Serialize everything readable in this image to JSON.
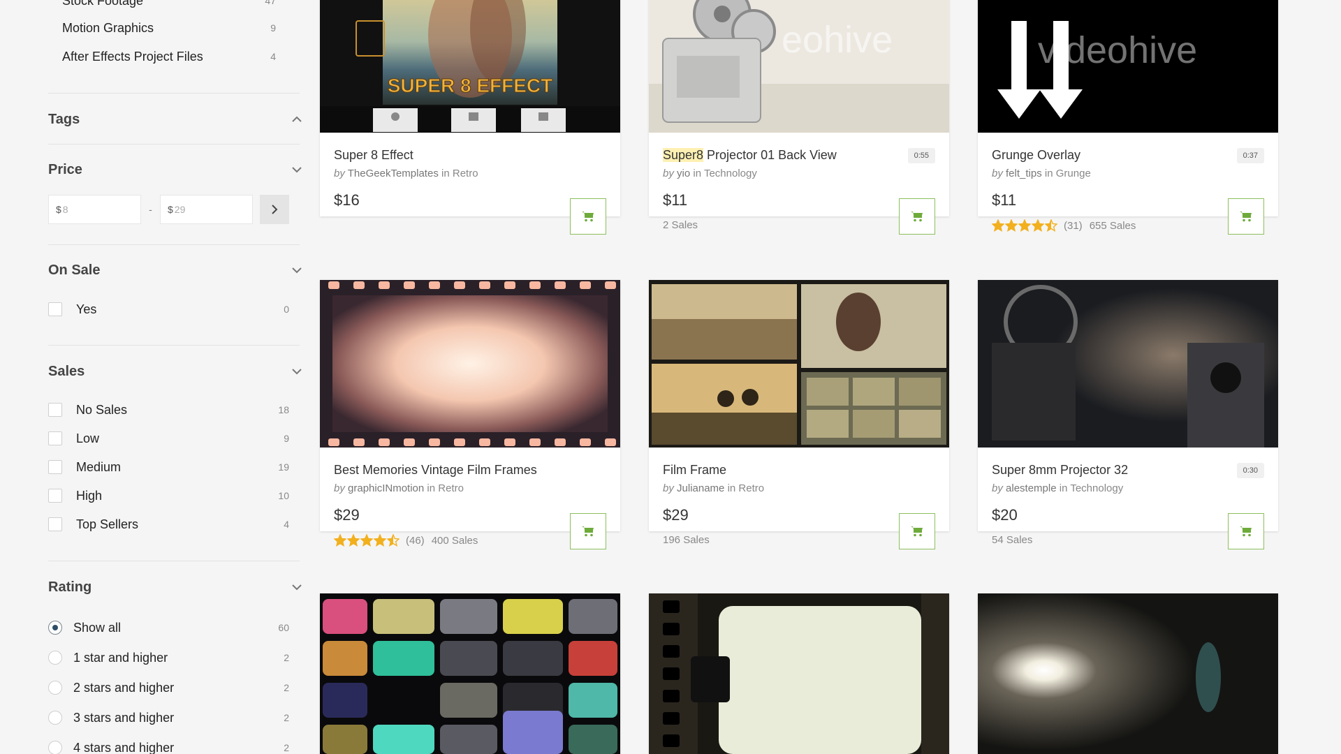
{
  "sidebar": {
    "categories": [
      {
        "label": "Stock Footage",
        "count": "47"
      },
      {
        "label": "Motion Graphics",
        "count": "9"
      },
      {
        "label": "After Effects Project Files",
        "count": "4"
      }
    ],
    "tags": {
      "title": "Tags"
    },
    "price": {
      "title": "Price",
      "currency": "$",
      "min_placeholder": "8",
      "separator": "-",
      "max_placeholder": "29"
    },
    "on_sale": {
      "title": "On Sale",
      "options": [
        {
          "label": "Yes",
          "count": "0"
        }
      ]
    },
    "sales": {
      "title": "Sales",
      "options": [
        {
          "label": "No Sales",
          "count": "18"
        },
        {
          "label": "Low",
          "count": "9"
        },
        {
          "label": "Medium",
          "count": "19"
        },
        {
          "label": "High",
          "count": "10"
        },
        {
          "label": "Top Sellers",
          "count": "4"
        }
      ]
    },
    "rating": {
      "title": "Rating",
      "selected": "Show all",
      "options": [
        {
          "label": "Show all",
          "count": "60"
        },
        {
          "label": "1 star and higher",
          "count": "2"
        },
        {
          "label": "2 stars and higher",
          "count": "2"
        },
        {
          "label": "3 stars and higher",
          "count": "2"
        },
        {
          "label": "4 stars and higher",
          "count": "2"
        }
      ]
    }
  },
  "items": [
    {
      "title": "Super 8 Effect",
      "highlight": "",
      "title_rest": "Super 8 Effect",
      "by": "by",
      "author": "TheGeekTemplates",
      "in": "in",
      "category": "Retro",
      "duration": "",
      "price": "$16",
      "rating": null,
      "rating_count": "",
      "sales": "",
      "thumb_text": "SUPER 8 EFFECT"
    },
    {
      "title": "Super8 Projector 01 Back View",
      "highlight": "Super8",
      "title_rest": " Projector 01 Back View",
      "by": "by",
      "author": "yio",
      "in": "in",
      "category": "Technology",
      "duration": "0:55",
      "price": "$11",
      "rating": null,
      "rating_count": "",
      "sales": "2 Sales",
      "thumb_text": "eohive"
    },
    {
      "title": "Grunge Overlay",
      "highlight": "",
      "title_rest": "Grunge Overlay",
      "by": "by",
      "author": "felt_tips",
      "in": "in",
      "category": "Grunge",
      "duration": "0:37",
      "price": "$11",
      "rating": 4.5,
      "rating_count": "(31)",
      "sales": "655 Sales",
      "thumb_text": "videohive"
    },
    {
      "title": "Best Memories Vintage Film Frames",
      "highlight": "",
      "title_rest": "Best Memories Vintage Film Frames",
      "by": "by",
      "author": "graphicINmotion",
      "in": "in",
      "category": "Retro",
      "duration": "",
      "price": "$29",
      "rating": 4.5,
      "rating_count": "(46)",
      "sales": "400 Sales",
      "thumb_text": ""
    },
    {
      "title": "Film Frame",
      "highlight": "",
      "title_rest": "Film Frame",
      "by": "by",
      "author": "Julianame",
      "in": "in",
      "category": "Retro",
      "duration": "",
      "price": "$29",
      "rating": null,
      "rating_count": "",
      "sales": "196 Sales",
      "thumb_text": ""
    },
    {
      "title": "Super 8mm Projector 32",
      "highlight": "",
      "title_rest": "Super 8mm Projector 32",
      "by": "by",
      "author": "alestemple",
      "in": "in",
      "category": "Technology",
      "duration": "0:30",
      "price": "$20",
      "rating": null,
      "rating_count": "",
      "sales": "54 Sales",
      "thumb_text": ""
    }
  ],
  "colors": {
    "cart_green": "#8cbf5e",
    "star_gold": "#f2b01e",
    "highlight": "#fdf0b2",
    "radio_selected": "#2e4d68"
  },
  "icons": {
    "collapse": "chevron-up-icon",
    "expand": "chevron-down-icon",
    "price_submit": "chevron-right-icon",
    "cart": "shopping-cart-icon",
    "rating": "star-icon"
  }
}
